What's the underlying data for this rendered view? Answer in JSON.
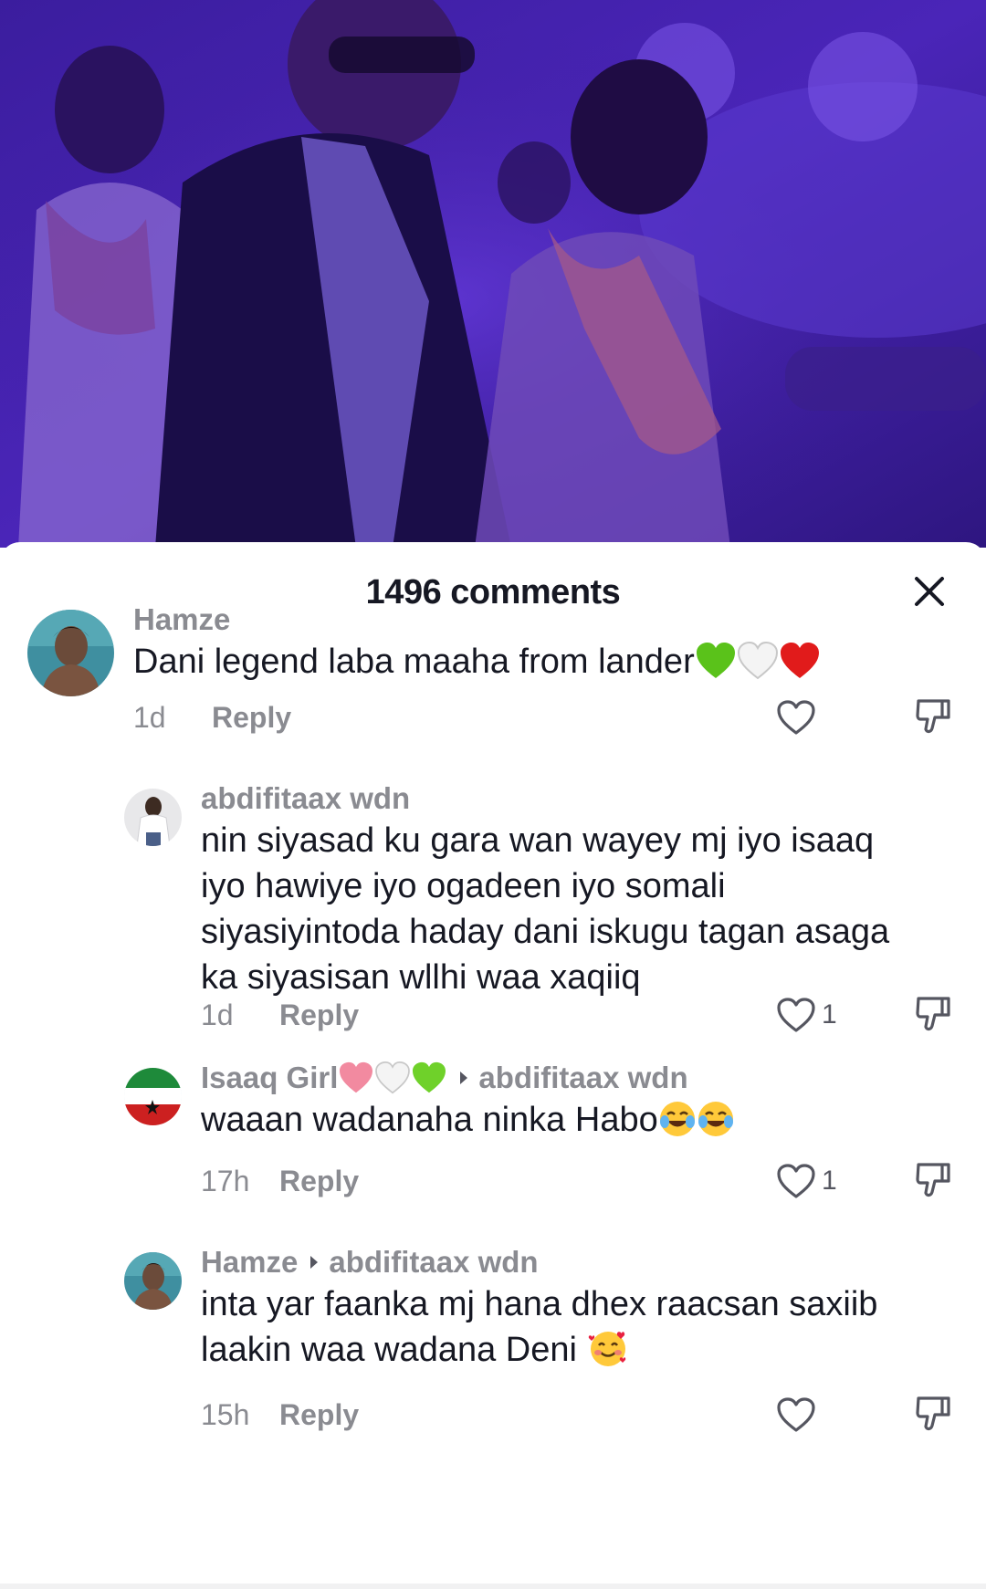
{
  "sheet": {
    "title": "1496 comments"
  },
  "comments": [
    {
      "username": "Hamze",
      "text": "Dani legend laba maaha from lander",
      "time": "1d",
      "reply_label": "Reply",
      "like_count": "",
      "emojis": [
        "green-heart",
        "white-heart",
        "red-heart"
      ]
    },
    {
      "username": "abdifitaax wdn",
      "text_lines": [
        "nin siyasad ku gara wan wayey mj iyo isaaq",
        "iyo hawiye iyo ogadeen iyo somali",
        "siyasiyintoda haday dani iskugu tagan asaga",
        "ka siyasisan wllhi waa xaqiiq"
      ],
      "time": "1d",
      "reply_label": "Reply",
      "like_count": "1"
    },
    {
      "username": "Isaaq Girl",
      "reply_to": "abdifitaax wdn",
      "text": "waaan wadanaha ninka Habo",
      "time": "17h",
      "reply_label": "Reply",
      "like_count": "1",
      "name_emojis": [
        "pink-heart",
        "white-heart",
        "green-heart"
      ],
      "emojis": [
        "tears-of-joy",
        "tears-of-joy"
      ]
    },
    {
      "username": "Hamze",
      "reply_to": "abdifitaax wdn",
      "text_lines": [
        "inta yar faanka mj hana dhex raacsan saxiib",
        "laakin waa wadana Deni"
      ],
      "time": "15h",
      "reply_label": "Reply",
      "like_count": "",
      "emojis": [
        "smiling-face-with-hearts"
      ]
    }
  ],
  "colors": {
    "video_tint": "#3a1b93",
    "text_primary": "#161823",
    "text_secondary": "#8a8b91"
  }
}
